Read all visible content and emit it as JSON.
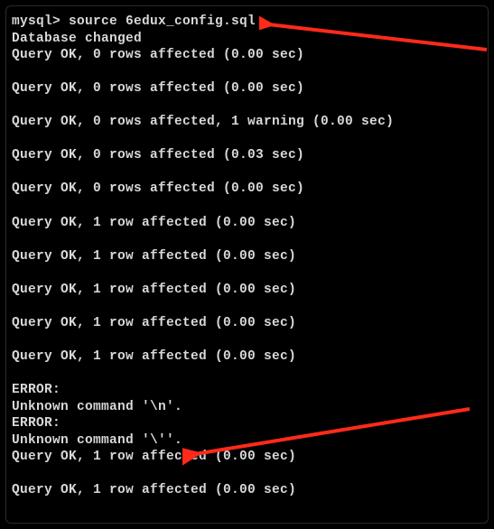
{
  "terminal": {
    "prompt": "mysql> ",
    "command": "source 6edux_config.sql",
    "lines": [
      "Database changed",
      "Query OK, 0 rows affected (0.00 sec)",
      "",
      "Query OK, 0 rows affected (0.00 sec)",
      "",
      "Query OK, 0 rows affected, 1 warning (0.00 sec)",
      "",
      "Query OK, 0 rows affected (0.03 sec)",
      "",
      "Query OK, 0 rows affected (0.00 sec)",
      "",
      "Query OK, 1 row affected (0.00 sec)",
      "",
      "Query OK, 1 row affected (0.00 sec)",
      "",
      "Query OK, 1 row affected (0.00 sec)",
      "",
      "Query OK, 1 row affected (0.00 sec)",
      "",
      "Query OK, 1 row affected (0.00 sec)",
      "",
      "ERROR:",
      "Unknown command '\\n'.",
      "ERROR:",
      "Unknown command '\\''.",
      "Query OK, 1 row affected (0.00 sec)",
      "",
      "Query OK, 1 row affected (0.00 sec)"
    ]
  },
  "annotations": {
    "arrow_color": "#ff2a1a"
  }
}
